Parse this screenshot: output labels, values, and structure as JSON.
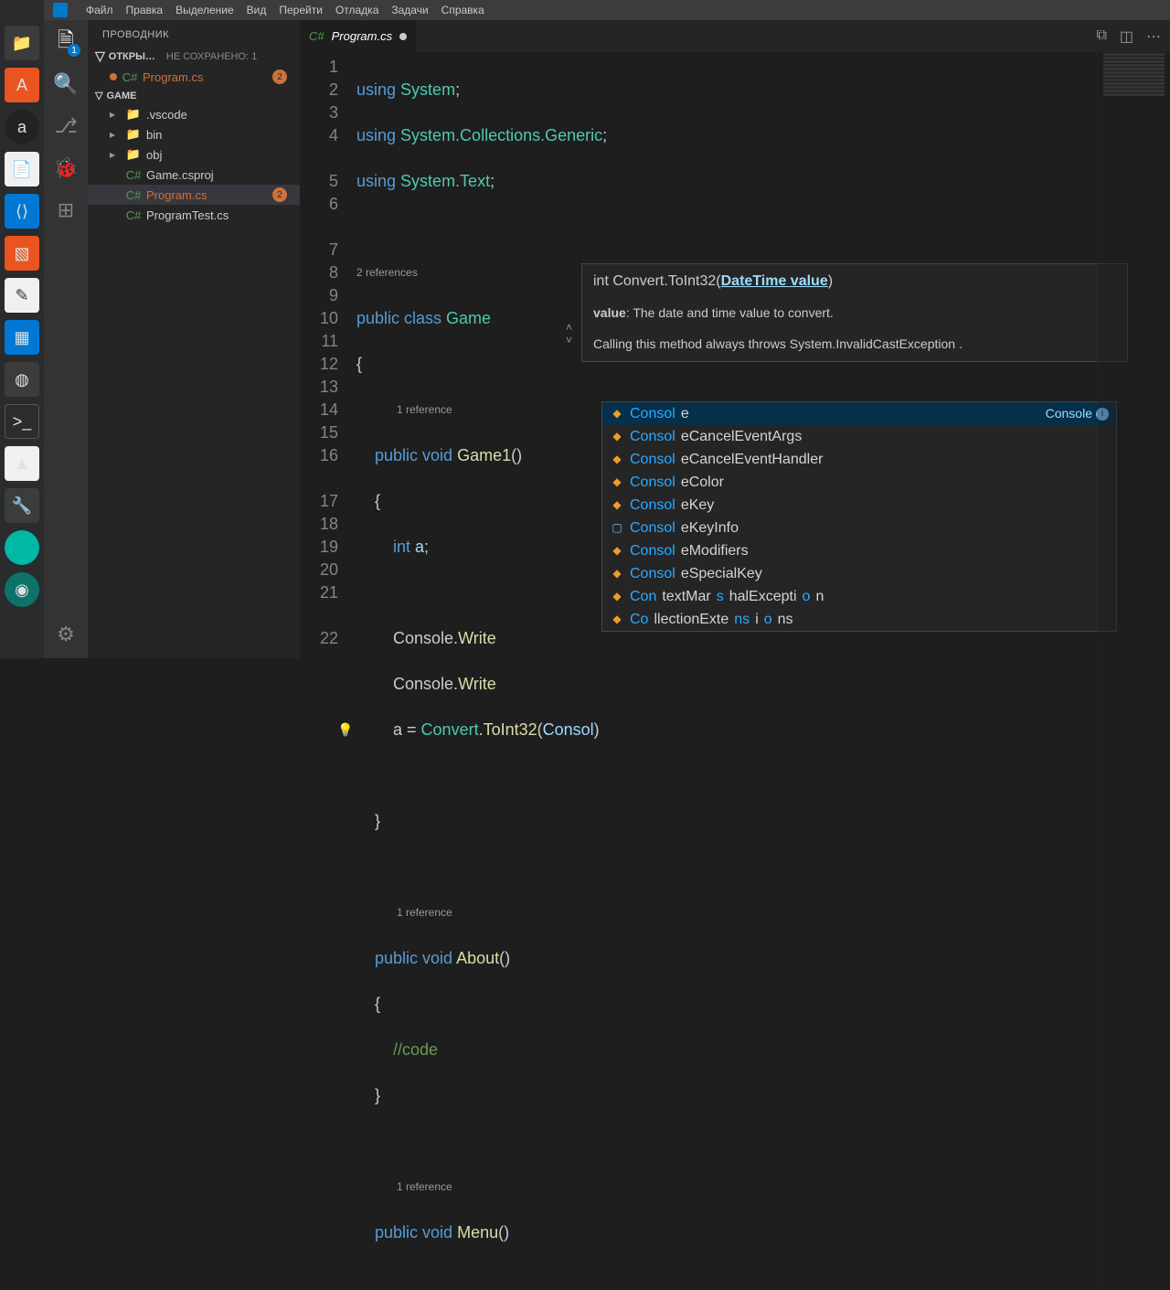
{
  "topmenu": [
    "Файл",
    "Правка",
    "Выделение",
    "Вид",
    "Перейти",
    "Отладка",
    "Задачи",
    "Справка"
  ],
  "explorer": {
    "title": "ПРОВОДНИК"
  },
  "open_editors": {
    "label": "ОТКРЫ…",
    "unsaved": "НЕ СОХРАНЕНО: 1",
    "file": "Program.cs",
    "badge": "2"
  },
  "project": {
    "name": "GAME",
    "items": [
      {
        "type": "folder",
        "label": ".vscode"
      },
      {
        "type": "folder",
        "label": "bin"
      },
      {
        "type": "folder",
        "label": "obj"
      },
      {
        "type": "cs",
        "label": "Game.csproj"
      },
      {
        "type": "cs",
        "label": "Program.cs",
        "err": true,
        "badge": "2",
        "selected": true
      },
      {
        "type": "cs",
        "label": "ProgramTest.cs"
      }
    ]
  },
  "tab": {
    "name": "Program.cs"
  },
  "gutter": [
    "1",
    "2",
    "3",
    "4",
    "",
    "5",
    "6",
    "",
    "7",
    "8",
    "9",
    "10",
    "11",
    "12",
    "13",
    "14",
    "15",
    "16",
    "",
    "17",
    "18",
    "19",
    "20",
    "21",
    "",
    "22"
  ],
  "code": {
    "l1a": "using ",
    "l1b": "System",
    "l1c": ";",
    "l2a": "using ",
    "l2b": "System.Collections.Generic",
    "l2c": ";",
    "l3a": "using ",
    "l3b": "System.Text",
    "l3c": ";",
    "refs2": "2 references",
    "l5a": "public ",
    "l5b": "class ",
    "l5c": "Game",
    "l6": "{",
    "ref1": "1 reference",
    "l7a": "    public ",
    "l7b": "void ",
    "l7c": "Game1",
    "l7d": "()",
    "l8": "    {",
    "l9a": "        ",
    "l9b": "int ",
    "l9c": "a",
    "l9d": ";",
    "l11a": "        Console.",
    "l11b": "Write",
    "l12a": "        Console.",
    "l12b": "Write",
    "l13a": "        a = ",
    "l13b": "Convert",
    "l13c": ".",
    "l13d": "ToInt32",
    "l13e": "(",
    "l13f": "Consol",
    "l13g": ")",
    "l15": "    }",
    "l16": "",
    "ref1b": "1 reference",
    "l17a": "    public ",
    "l17b": "void ",
    "l17c": "About",
    "l17d": "()",
    "l18": "    {",
    "l19a": "        ",
    "l19b": "//code",
    "l20": "    }",
    "ref1c": "1 reference",
    "l22a": "    public ",
    "l22b": "void ",
    "l22c": "Menu",
    "l22d": "()"
  },
  "sighelp": {
    "sig_pre": "int Convert.ToInt32(",
    "sig_param": "DateTime value",
    "sig_post": ")",
    "desc_label": "value",
    "desc_text": ": The date and time value to convert.",
    "throw": "Calling this method always throws System.InvalidCastException ."
  },
  "autocomplete": {
    "detail_label": "Console",
    "items": [
      {
        "icon": "cls",
        "match": "Consol",
        "rest": "e",
        "sel": true
      },
      {
        "icon": "cls",
        "match": "Consol",
        "rest": "eCancelEventArgs"
      },
      {
        "icon": "cls",
        "match": "Consol",
        "rest": "eCancelEventHandler"
      },
      {
        "icon": "cls",
        "match": "Consol",
        "rest": "eColor"
      },
      {
        "icon": "cls",
        "match": "Consol",
        "rest": "eKey"
      },
      {
        "icon": "strc",
        "match": "Consol",
        "rest": "eKeyInfo"
      },
      {
        "icon": "cls",
        "match": "Consol",
        "rest": "eModifiers"
      },
      {
        "icon": "cls",
        "match": "Consol",
        "rest": "eSpecialKey"
      },
      {
        "icon": "cls",
        "match": "Con",
        "rest": "textMarshalException",
        "alt": true
      },
      {
        "icon": "cls",
        "match": "Col",
        "rest": "lectionExtensions",
        "alt2": true
      }
    ]
  }
}
